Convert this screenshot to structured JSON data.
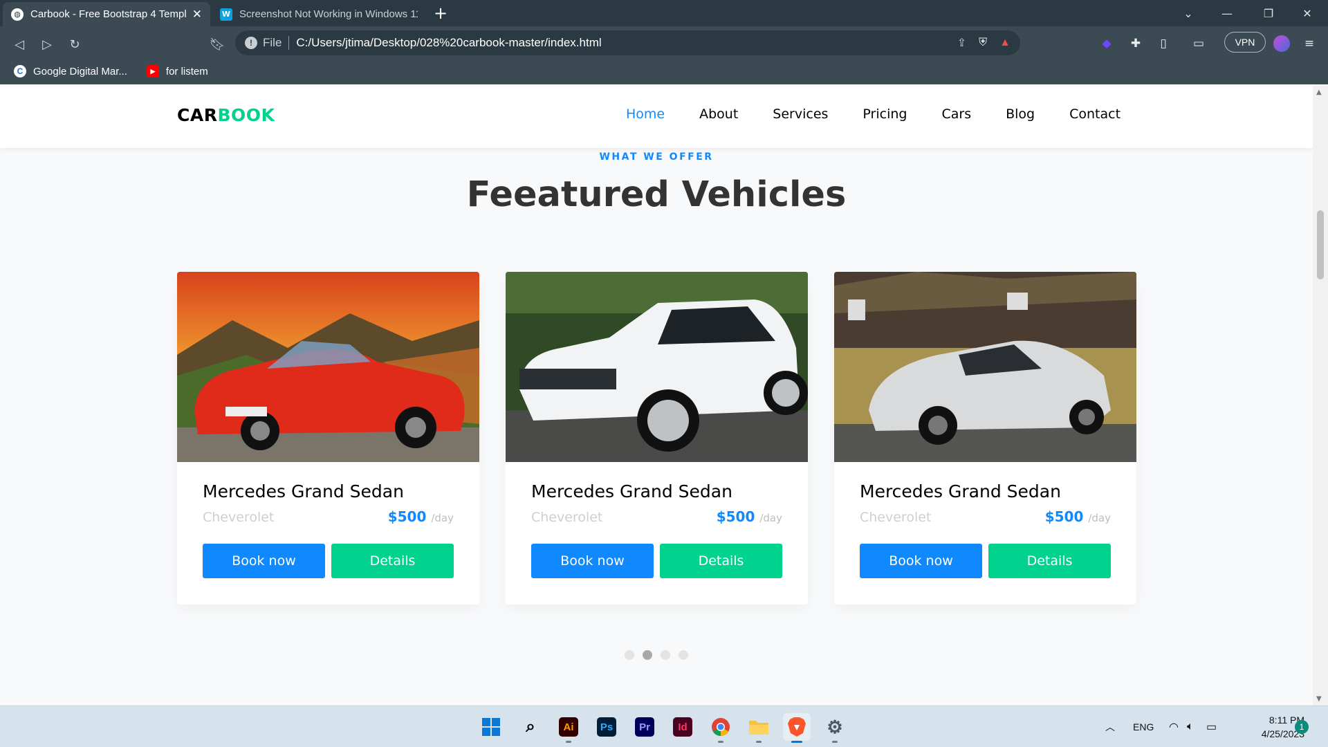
{
  "browser": {
    "tabs": [
      {
        "title": "Carbook - Free Bootstrap 4 Template",
        "active": true
      },
      {
        "title": "Screenshot Not Working in Windows 11",
        "active": false
      }
    ],
    "new_tab": "+",
    "address": {
      "scheme": "File",
      "url": "C:/Users/jtima/Desktop/028%20carbook-master/index.html"
    },
    "vpn_label": "VPN",
    "bookmarks": [
      {
        "label": "Google Digital Mar...",
        "icon": "google-icon",
        "color": "#1a73e8"
      },
      {
        "label": "for listem",
        "icon": "youtube-icon",
        "color": "#ff0000"
      }
    ]
  },
  "site": {
    "brand_part1": "CAR",
    "brand_part2": "BOOK",
    "brand_accent": "#01d28e",
    "nav": [
      "Home",
      "About",
      "Services",
      "Pricing",
      "Cars",
      "Blog",
      "Contact"
    ],
    "nav_active": "Home",
    "subheading": "WHAT WE OFFER",
    "heading": "Feeatured Vehicles",
    "primary_color": "#1089ff",
    "cars": [
      {
        "name": "Mercedes Grand Sedan",
        "category": "Cheverolet",
        "price": "$500",
        "per": "/day",
        "book": "Book now",
        "details": "Details",
        "image": "red-convertible"
      },
      {
        "name": "Mercedes Grand Sedan",
        "category": "Cheverolet",
        "price": "$500",
        "per": "/day",
        "book": "Book now",
        "details": "Details",
        "image": "white-suv"
      },
      {
        "name": "Mercedes Grand Sedan",
        "category": "Cheverolet",
        "price": "$500",
        "per": "/day",
        "book": "Book now",
        "details": "Details",
        "image": "silver-supercar"
      }
    ],
    "carousel_dots": 4,
    "carousel_active": 2
  },
  "taskbar": {
    "apps": [
      "start-icon",
      "search-icon",
      "illustrator-icon",
      "photoshop-icon",
      "premiere-icon",
      "indesign-icon",
      "chrome-icon",
      "file-explorer-icon",
      "brave-icon",
      "settings-icon"
    ],
    "app_labels": {
      "illustrator": "Ai",
      "photoshop": "Ps",
      "premiere": "Pr",
      "indesign": "Id"
    },
    "language": "ENG",
    "time": "8:11 PM",
    "date": "4/25/2023",
    "notifications": "1"
  }
}
